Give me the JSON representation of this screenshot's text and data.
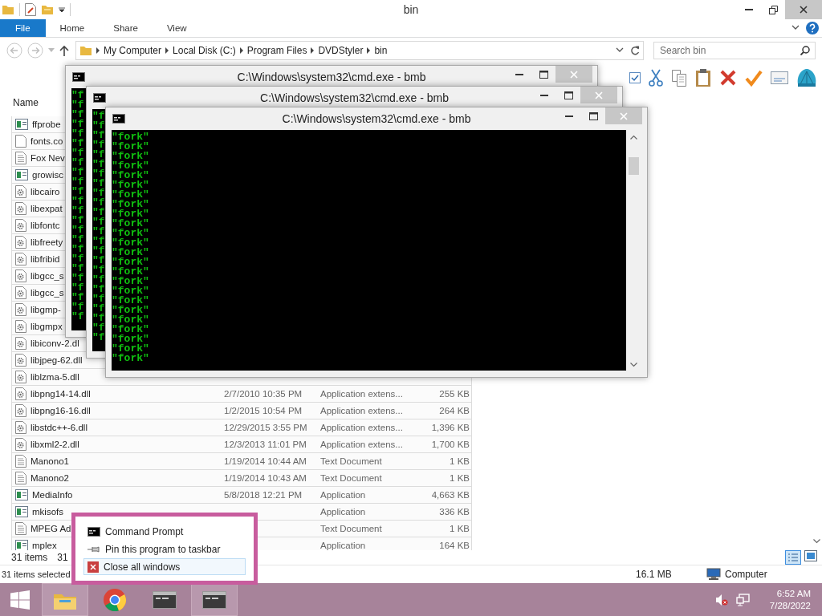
{
  "explorer": {
    "title": "bin",
    "ribbon_tabs": [
      {
        "label": "File",
        "selected": true
      },
      {
        "label": "Home",
        "selected": false
      },
      {
        "label": "Share",
        "selected": false
      },
      {
        "label": "View",
        "selected": false
      }
    ],
    "breadcrumbs": [
      "My Computer",
      "Local Disk (C:)",
      "Program Files",
      "DVDStyler",
      "bin"
    ],
    "search": {
      "placeholder": "Search bin"
    },
    "column_header": "Name",
    "files": [
      {
        "kind": "app",
        "name": "ffprobe"
      },
      {
        "kind": "file",
        "name": "fonts.co"
      },
      {
        "kind": "text",
        "name": "Fox Nev"
      },
      {
        "kind": "app",
        "name": "growisc"
      },
      {
        "kind": "dll",
        "name": "libcairo"
      },
      {
        "kind": "dll",
        "name": "libexpat"
      },
      {
        "kind": "dll",
        "name": "libfontc"
      },
      {
        "kind": "dll",
        "name": "libfreety"
      },
      {
        "kind": "dll",
        "name": "libfribid"
      },
      {
        "kind": "dll",
        "name": "libgcc_s"
      },
      {
        "kind": "dll",
        "name": "libgcc_s"
      },
      {
        "kind": "dll",
        "name": "libgmp-"
      },
      {
        "kind": "dll",
        "name": "libgmpx"
      },
      {
        "kind": "dll",
        "name": "libiconv-2.dl"
      },
      {
        "kind": "dll",
        "name": "libjpeg-62.dll"
      },
      {
        "kind": "dll",
        "name": "liblzma-5.dll"
      },
      {
        "kind": "dll",
        "name": "libpng14-14.dll",
        "date": "2/7/2010 10:35 PM",
        "type": "Application extens...",
        "size": "255 KB"
      },
      {
        "kind": "dll",
        "name": "libpng16-16.dll",
        "date": "1/2/2015 10:54 PM",
        "type": "Application extens...",
        "size": "264 KB"
      },
      {
        "kind": "dll",
        "name": "libstdc++-6.dll",
        "date": "12/29/2015 3:55 PM",
        "type": "Application extens...",
        "size": "1,396 KB"
      },
      {
        "kind": "dll",
        "name": "libxml2-2.dll",
        "date": "12/3/2013 11:01 PM",
        "type": "Application extens...",
        "size": "1,700 KB"
      },
      {
        "kind": "text",
        "name": "Manono1",
        "date": "1/19/2014 10:44 AM",
        "type": "Text Document",
        "size": "1 KB"
      },
      {
        "kind": "text",
        "name": "Manono2",
        "date": "1/19/2014 10:43 AM",
        "type": "Text Document",
        "size": "1 KB"
      },
      {
        "kind": "app",
        "name": "MediaInfo",
        "date": "5/8/2018 12:21 PM",
        "type": "Application",
        "size": "4,663 KB"
      },
      {
        "kind": "app",
        "name": "mkisofs",
        "type": "Application",
        "size": "336 KB"
      },
      {
        "kind": "text",
        "name": "MPEG Ad",
        "type": "Text Document",
        "size": "1 KB"
      },
      {
        "kind": "app",
        "name": "mplex",
        "type": "Application",
        "size": "164 KB"
      }
    ],
    "item_count": "31 items",
    "selection_count": "31",
    "status_bar": {
      "selected": "31 items selected",
      "size": "16.1 MB",
      "location": "Computer"
    }
  },
  "cmd_windows": [
    {
      "title": "C:\\Windows\\system32\\cmd.exe - bmb",
      "lines": [
        "\"f",
        "\"f",
        "\"f",
        "\"f",
        "\"f",
        "\"f",
        "\"f",
        "\"f",
        "\"f",
        "\"f",
        "\"f",
        "\"f",
        "\"f",
        "\"f",
        "\"f",
        "\"f",
        "\"f",
        "\"f",
        "\"f",
        "\"f",
        "\"f",
        "\"f",
        "\"f",
        "\"f"
      ]
    },
    {
      "title": "C:\\Windows\\system32\\cmd.exe - bmb",
      "lines": [
        "\"f",
        "\"f",
        "\"f",
        "\"f",
        "\"f",
        "\"f",
        "\"f",
        "\"f",
        "\"f",
        "\"f",
        "\"f",
        "\"f",
        "\"f",
        "\"f",
        "\"f",
        "\"f",
        "\"f",
        "\"f",
        "\"f",
        "\"f",
        "\"f",
        "\"f",
        "\"f",
        "\"f"
      ]
    },
    {
      "title": "C:\\Windows\\system32\\cmd.exe - bmb",
      "lines": [
        "\"fork\"",
        "\"fork\"",
        "\"fork\"",
        "\"fork\"",
        "\"fork\"",
        "\"fork\"",
        "\"fork\"",
        "\"fork\"",
        "\"fork\"",
        "\"fork\"",
        "\"fork\"",
        "\"fork\"",
        "\"fork\"",
        "\"fork\"",
        "\"fork\"",
        "\"fork\"",
        "\"fork\"",
        "\"fork\"",
        "\"fork\"",
        "\"fork\"",
        "\"fork\"",
        "\"fork\"",
        "\"fork\"",
        "\"fork\""
      ]
    }
  ],
  "jump_list": {
    "items": [
      {
        "kind": "program",
        "label": "Command Prompt",
        "selected": false
      },
      {
        "kind": "pin",
        "label": "Pin this program to taskbar",
        "selected": false
      },
      {
        "kind": "close",
        "label": "Close all windows",
        "selected": true
      }
    ]
  },
  "taskbar": {
    "apps": [
      {
        "kind": "explorer",
        "selected": true
      },
      {
        "kind": "chrome",
        "selected": false
      },
      {
        "kind": "cmd",
        "selected": false
      },
      {
        "kind": "cmd",
        "selected": true
      }
    ],
    "clock": {
      "time": "6:52 AM",
      "date": "7/28/2022"
    }
  }
}
